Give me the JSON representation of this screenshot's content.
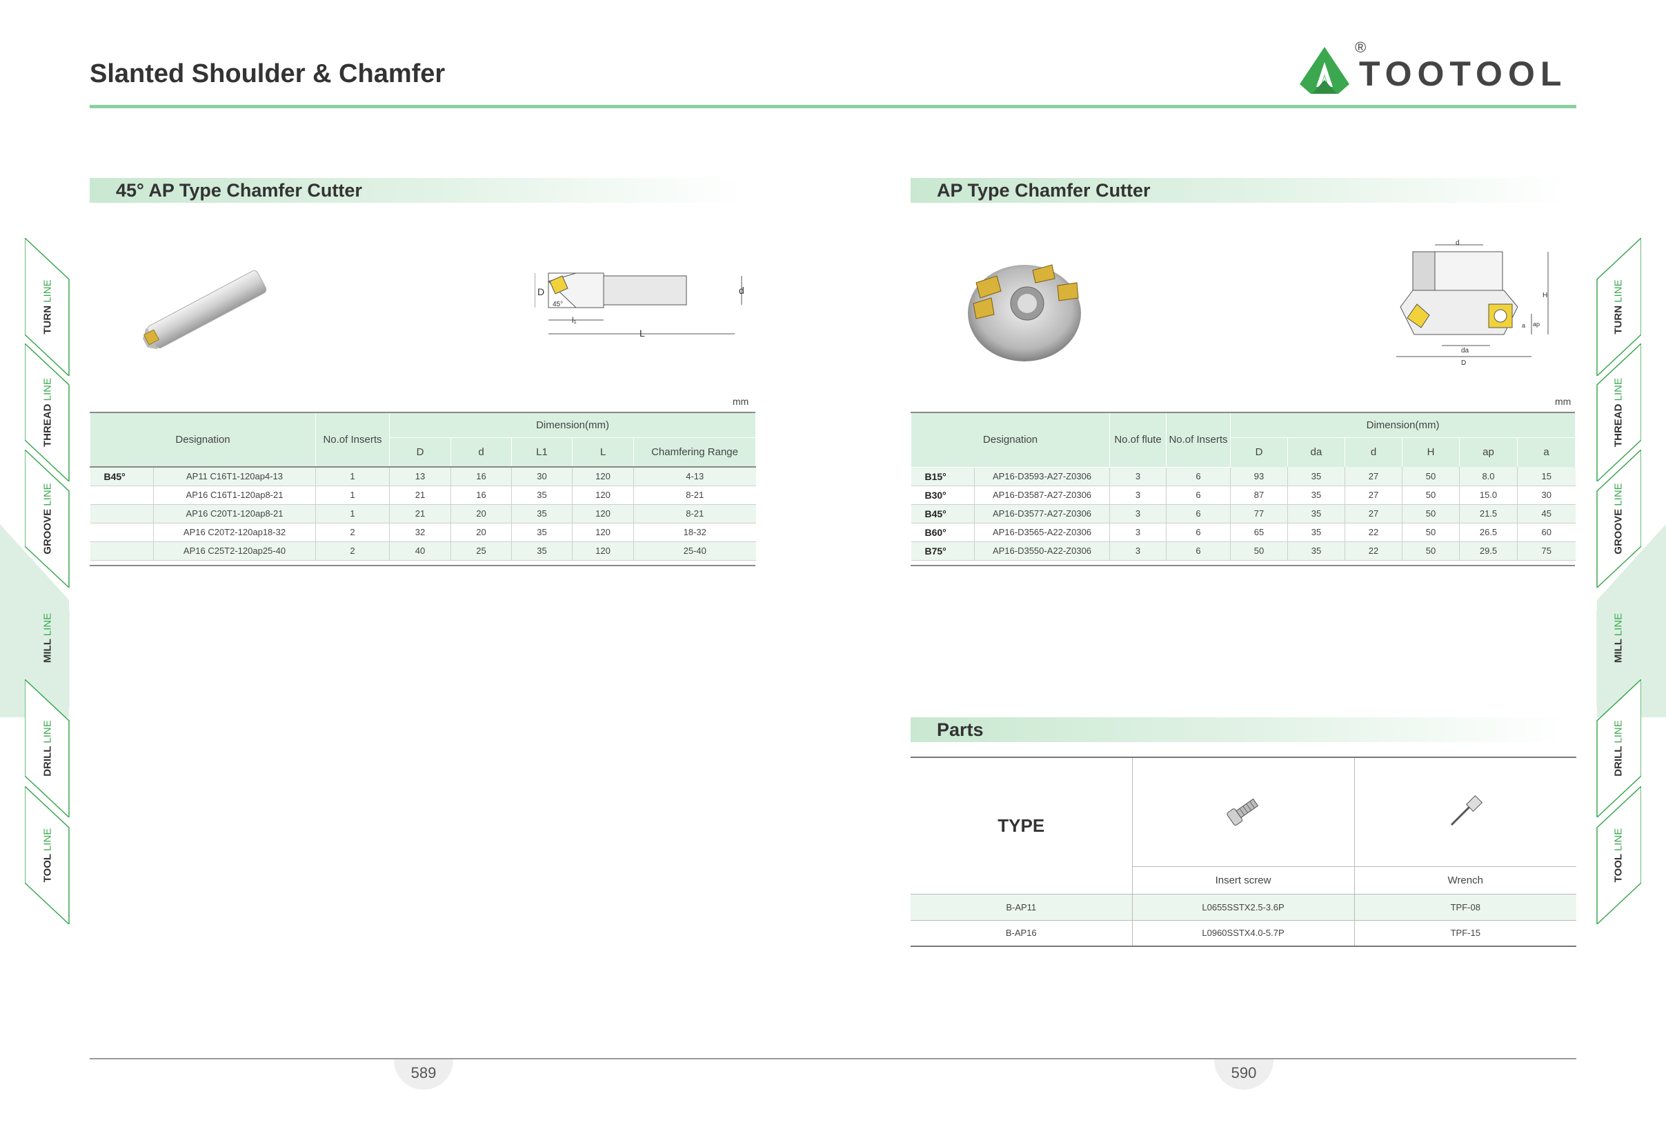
{
  "header": {
    "title": "Slanted Shoulder & Chamfer",
    "logo_text": "TOOTOOL",
    "logo_reg": "®"
  },
  "colors": {
    "accent": "#3ba84f",
    "header_bg": "#d9efe0",
    "rule": "#8ccfa0"
  },
  "tabs": [
    {
      "word": "TURN",
      "suffix": "LINE"
    },
    {
      "word": "THREAD",
      "suffix": "LINE"
    },
    {
      "word": "GROOVE",
      "suffix": "LINE"
    },
    {
      "word": "MILL",
      "suffix": "LINE"
    },
    {
      "word": "DRILL",
      "suffix": "LINE"
    },
    {
      "word": "TOOL",
      "suffix": "LINE"
    }
  ],
  "left": {
    "section_title": "45° AP Type Chamfer Cutter",
    "unit": "mm",
    "diagram_labels": {
      "D": "D",
      "d": "d",
      "l1": "l₁",
      "L": "L",
      "angle": "45°"
    },
    "table": {
      "headers": {
        "designation": "Designation",
        "inserts": "No.of  Inserts",
        "dimension": "Dimension(mm)",
        "D": "D",
        "d": "d",
        "L1": "L1",
        "L": "L",
        "range": "Chamfering Range"
      },
      "rows": [
        {
          "grade": "B45°",
          "designation": "AP11 C16T1-120ap4-13",
          "inserts": "1",
          "D": "13",
          "d": "16",
          "L1": "30",
          "L": "120",
          "range": "4-13"
        },
        {
          "grade": "",
          "designation": "AP16 C16T1-120ap8-21",
          "inserts": "1",
          "D": "21",
          "d": "16",
          "L1": "35",
          "L": "120",
          "range": "8-21"
        },
        {
          "grade": "",
          "designation": "AP16 C20T1-120ap8-21",
          "inserts": "1",
          "D": "21",
          "d": "20",
          "L1": "35",
          "L": "120",
          "range": "8-21"
        },
        {
          "grade": "",
          "designation": "AP16 C20T2-120ap18-32",
          "inserts": "2",
          "D": "32",
          "d": "20",
          "L1": "35",
          "L": "120",
          "range": "18-32"
        },
        {
          "grade": "",
          "designation": "AP16 C25T2-120ap25-40",
          "inserts": "2",
          "D": "40",
          "d": "25",
          "L1": "35",
          "L": "120",
          "range": "25-40"
        }
      ]
    }
  },
  "right": {
    "section_title": "AP Type Chamfer Cutter",
    "unit": "mm",
    "diagram_labels": {
      "d": "d",
      "H": "H",
      "ap": "ap",
      "a": "a",
      "da": "da",
      "D": "D"
    },
    "table": {
      "headers": {
        "designation": "Designation",
        "flute": "No.of flute",
        "inserts": "No.of Inserts",
        "dimension": "Dimension(mm)",
        "D": "D",
        "da": "da",
        "d": "d",
        "H": "H",
        "ap": "ap",
        "a": "a"
      },
      "rows": [
        {
          "grade": "B15°",
          "designation": "AP16-D3593-A27-Z0306",
          "flute": "3",
          "inserts": "6",
          "D": "93",
          "da": "35",
          "d": "27",
          "H": "50",
          "ap": "8.0",
          "a": "15"
        },
        {
          "grade": "B30°",
          "designation": "AP16-D3587-A27-Z0306",
          "flute": "3",
          "inserts": "6",
          "D": "87",
          "da": "35",
          "d": "27",
          "H": "50",
          "ap": "15.0",
          "a": "30"
        },
        {
          "grade": "B45°",
          "designation": "AP16-D3577-A27-Z0306",
          "flute": "3",
          "inserts": "6",
          "D": "77",
          "da": "35",
          "d": "27",
          "H": "50",
          "ap": "21.5",
          "a": "45"
        },
        {
          "grade": "B60°",
          "designation": "AP16-D3565-A22-Z0306",
          "flute": "3",
          "inserts": "6",
          "D": "65",
          "da": "35",
          "d": "22",
          "H": "50",
          "ap": "26.5",
          "a": "60"
        },
        {
          "grade": "B75°",
          "designation": "AP16-D3550-A22-Z0306",
          "flute": "3",
          "inserts": "6",
          "D": "50",
          "da": "35",
          "d": "22",
          "H": "50",
          "ap": "29.5",
          "a": "75"
        }
      ]
    }
  },
  "parts": {
    "section_title": "Parts",
    "type_label": "TYPE",
    "col1": "Insert screw",
    "col2": "Wrench",
    "rows": [
      {
        "type": "B-AP11",
        "screw": "L0655SSTX2.5-3.6P",
        "wrench": "TPF-08"
      },
      {
        "type": "B-AP16",
        "screw": "L0960SSTX4.0-5.7P",
        "wrench": "TPF-15"
      }
    ]
  },
  "footer": {
    "left_page": "589",
    "right_page": "590"
  }
}
